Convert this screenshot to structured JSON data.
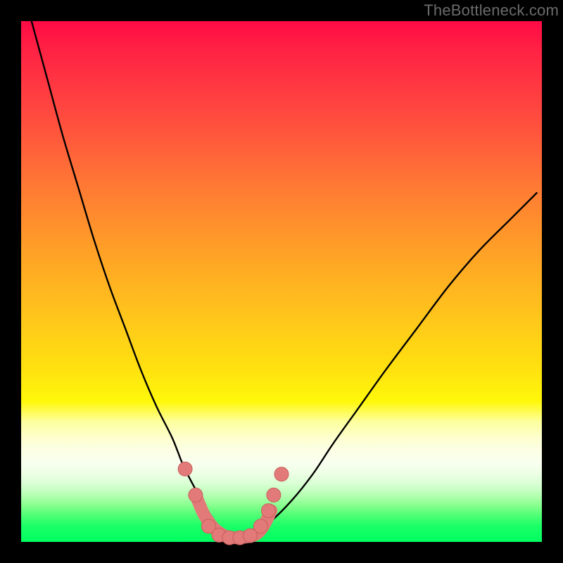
{
  "watermark": "TheBottleneck.com",
  "colors": {
    "frame": "#000000",
    "curve": "#000000",
    "dot_fill": "#e17a78",
    "dot_stroke": "#c95f5d"
  },
  "chart_data": {
    "type": "line",
    "title": "",
    "xlabel": "",
    "ylabel": "",
    "xlim": [
      0,
      100
    ],
    "ylim": [
      0,
      100
    ],
    "series": [
      {
        "name": "bottleneck-curve",
        "x": [
          2,
          5,
          8,
          11,
          14,
          17,
          20,
          23,
          26,
          29,
          31,
          33,
          35,
          36.5,
          38,
          39.5,
          41,
          43,
          45,
          48,
          52,
          56,
          60,
          65,
          70,
          76,
          82,
          88,
          94,
          99
        ],
        "values": [
          100,
          89,
          78,
          68,
          58,
          49,
          41,
          33,
          26,
          20,
          15,
          11,
          7.5,
          5,
          3,
          1.7,
          1,
          1,
          2,
          4,
          8,
          13,
          19,
          26,
          33,
          41,
          49,
          56,
          62,
          67
        ]
      }
    ],
    "dots": [
      {
        "x": 31.5,
        "y": 14
      },
      {
        "x": 33.5,
        "y": 9
      },
      {
        "x": 36,
        "y": 3
      },
      {
        "x": 38,
        "y": 1.3
      },
      {
        "x": 40,
        "y": 0.8
      },
      {
        "x": 42,
        "y": 0.8
      },
      {
        "x": 44,
        "y": 1.2
      },
      {
        "x": 46,
        "y": 3
      },
      {
        "x": 47.5,
        "y": 6
      },
      {
        "x": 48.5,
        "y": 9
      },
      {
        "x": 50,
        "y": 13
      }
    ],
    "thick_segment": {
      "x": [
        33.5,
        35,
        36.5,
        38,
        39.5,
        41,
        43,
        45,
        46.5,
        48
      ],
      "values": [
        9,
        5.5,
        3.2,
        1.8,
        1.0,
        0.8,
        0.9,
        1.4,
        3.0,
        6.0
      ]
    }
  }
}
